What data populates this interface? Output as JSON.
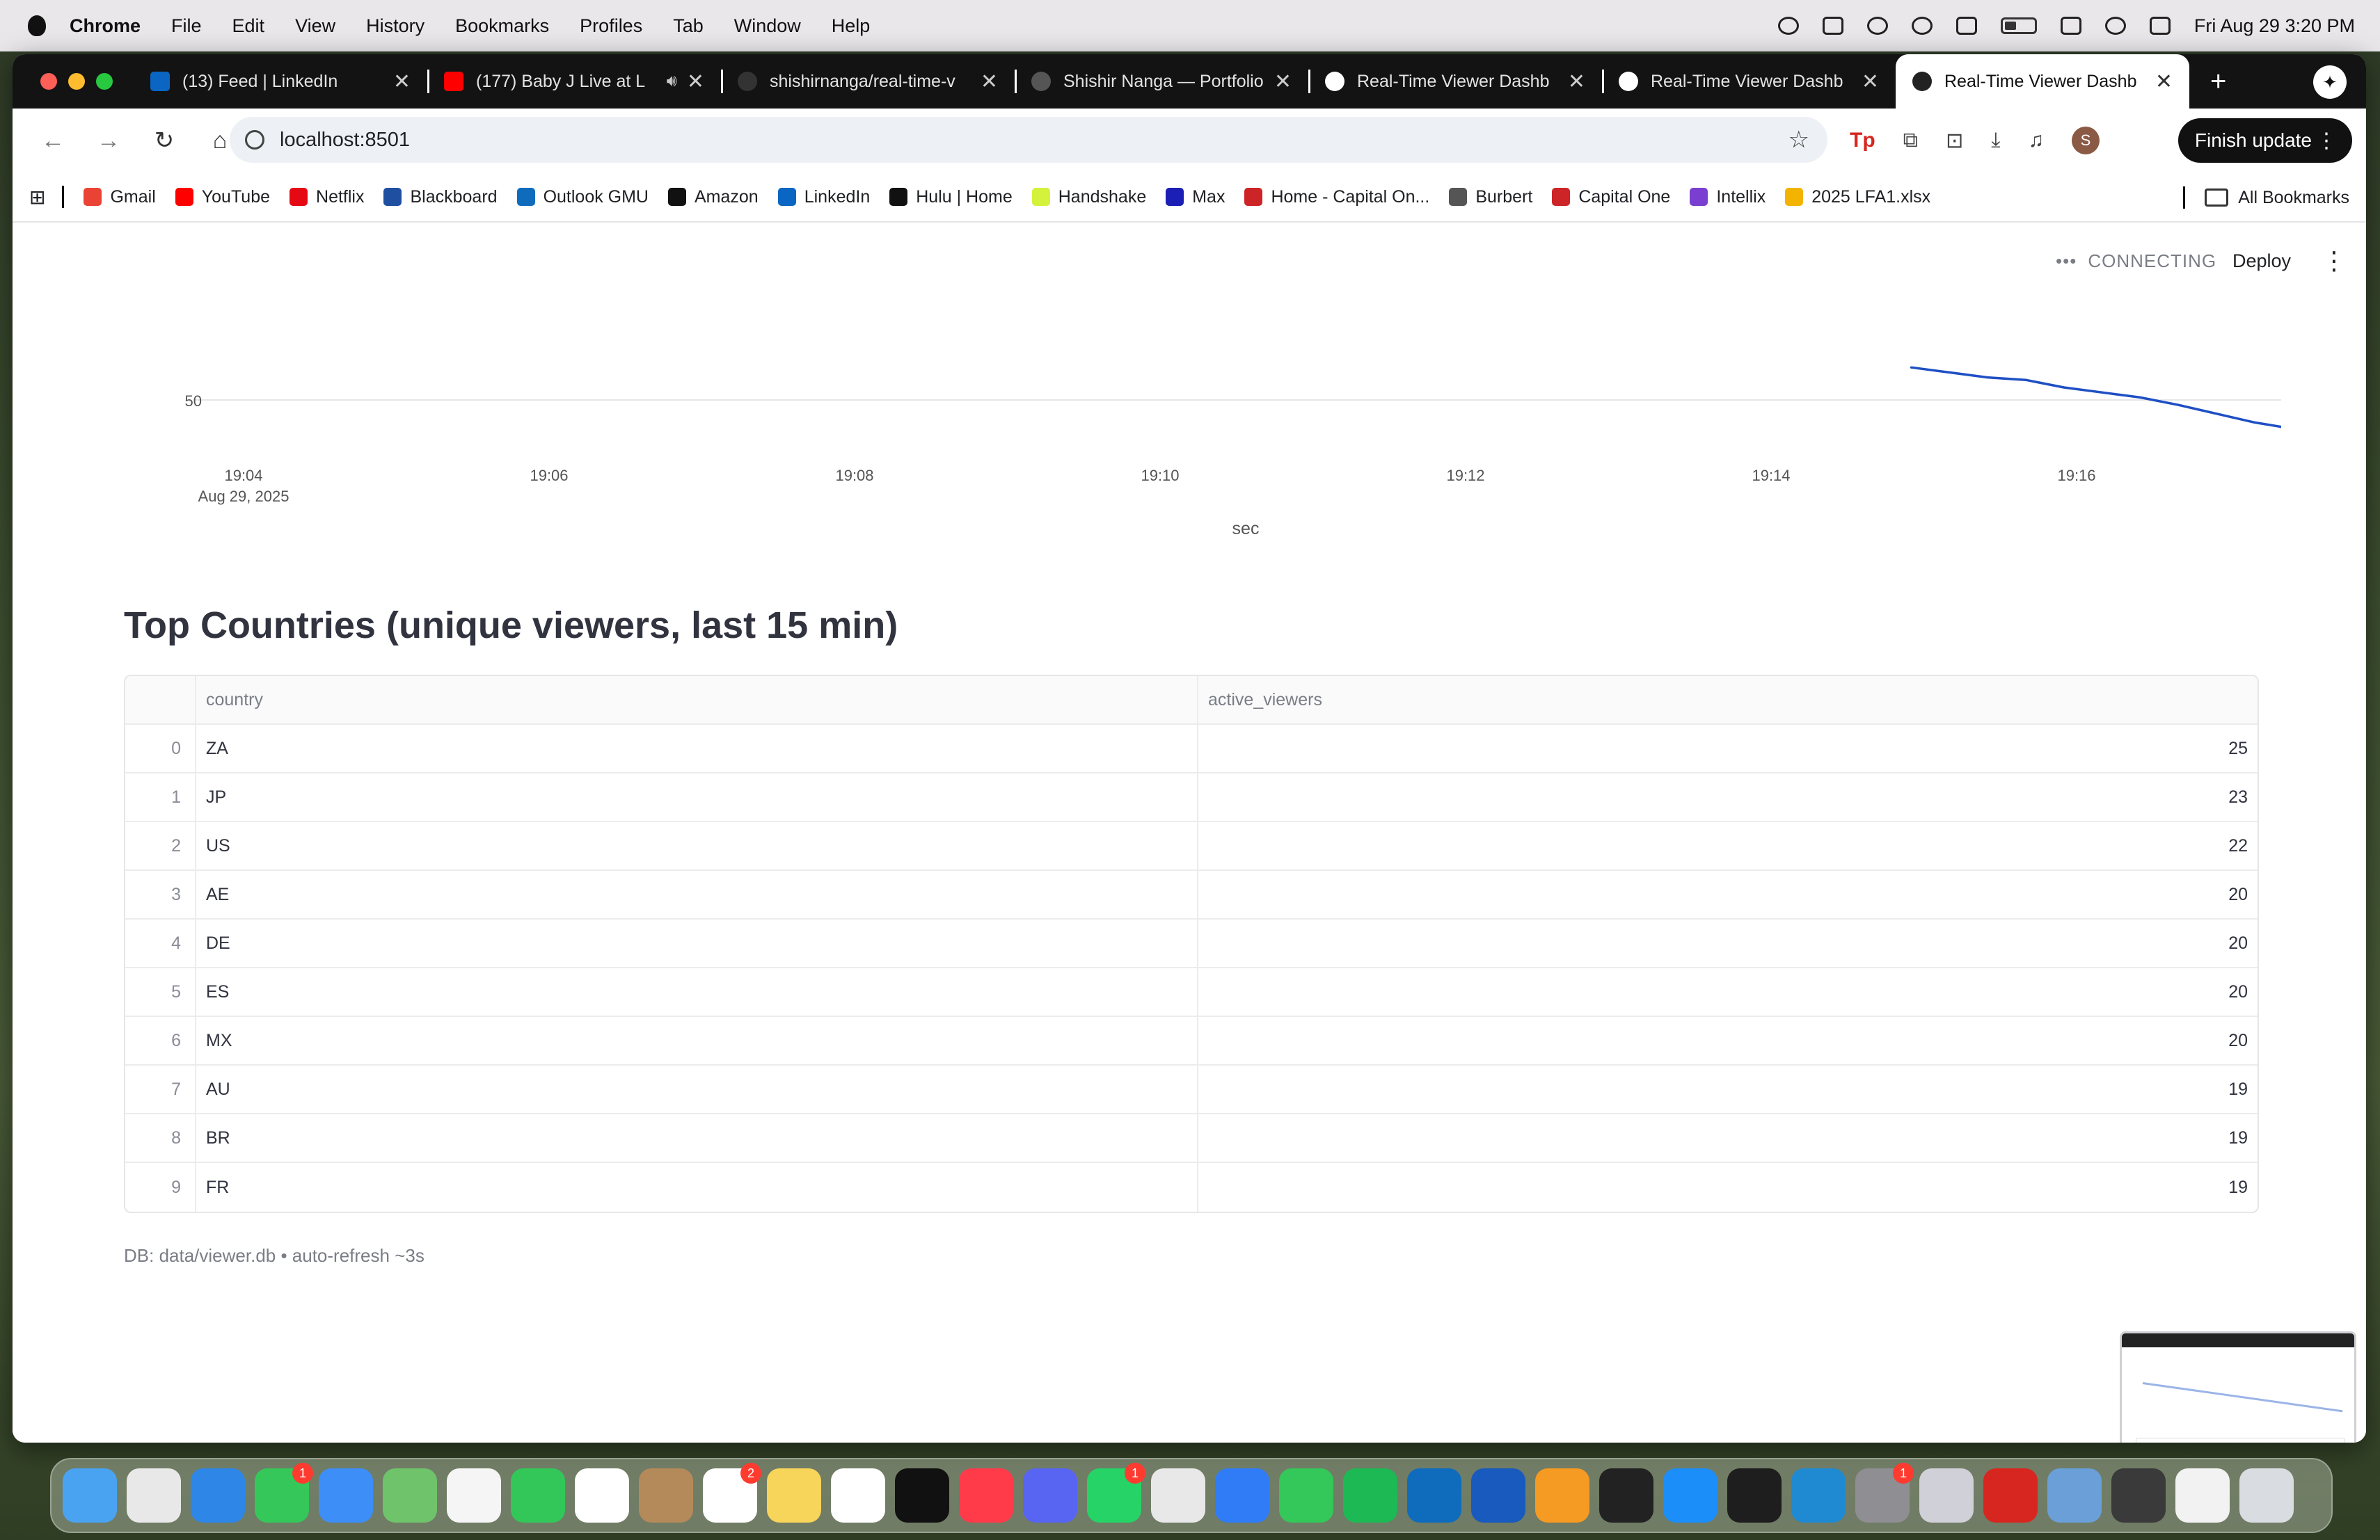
{
  "menubar": {
    "app": "Chrome",
    "items": [
      "File",
      "Edit",
      "View",
      "History",
      "Bookmarks",
      "Profiles",
      "Tab",
      "Window",
      "Help"
    ],
    "clock": "Fri Aug 29  3:20 PM"
  },
  "tabs": [
    {
      "title": "(13) Feed | LinkedIn",
      "color": "#0a66c2"
    },
    {
      "title": "(177) Baby J Live at L",
      "color": "#ff0000"
    },
    {
      "title": "shishirnanga/real-time-v",
      "color": "#333333"
    },
    {
      "title": "Shishir Nanga — Portfolio",
      "color": "#555555"
    },
    {
      "title": "Real-Time Viewer Dashb",
      "color": "#ffffff"
    },
    {
      "title": "Real-Time Viewer Dashb",
      "color": "#ffffff"
    },
    {
      "title": "Real-Time Viewer Dashb",
      "color": "#222222"
    }
  ],
  "address": {
    "url": "localhost:8501"
  },
  "finish_update": "Finish update",
  "avatar_letter": "S",
  "bookmarks": [
    {
      "label": "Gmail",
      "color": "#ea4335"
    },
    {
      "label": "YouTube",
      "color": "#ff0000"
    },
    {
      "label": "Netflix",
      "color": "#e50914"
    },
    {
      "label": "Blackboard",
      "color": "#1f4fa0"
    },
    {
      "label": "Outlook GMU",
      "color": "#0f6cbd"
    },
    {
      "label": "Amazon",
      "color": "#111111"
    },
    {
      "label": "LinkedIn",
      "color": "#0a66c2"
    },
    {
      "label": "Hulu | Home",
      "color": "#111111"
    },
    {
      "label": "Handshake",
      "color": "#d4f23b"
    },
    {
      "label": "Max",
      "color": "#1b1fb5"
    },
    {
      "label": "Home - Capital On...",
      "color": "#cc2427"
    },
    {
      "label": "Burbert",
      "color": "#555555"
    },
    {
      "label": "Capital One",
      "color": "#cc2427"
    },
    {
      "label": "Intellix",
      "color": "#7a3fd1"
    },
    {
      "label": "2025 LFA1.xlsx",
      "color": "#f2b400"
    }
  ],
  "all_bookmarks": "All Bookmarks",
  "app": {
    "status": "CONNECTING",
    "deploy": "Deploy",
    "section_title": "Top Countries (unique viewers, last 15 min)",
    "caption": "DB: data/viewer.db • auto-refresh ~3s"
  },
  "chart_data": {
    "type": "line",
    "xlabel": "sec",
    "ylabel": "",
    "y_tick": "50",
    "x_ticks": [
      "19:04",
      "19:06",
      "19:08",
      "19:10",
      "19:12",
      "19:14",
      "19:16"
    ],
    "x_sub": "Aug 29, 2025",
    "color": "#1f4fc4",
    "series": [
      {
        "x": [
          "19:14:55",
          "19:15:10",
          "19:15:25",
          "19:15:40",
          "19:15:55",
          "19:16:10",
          "19:16:25",
          "19:16:40",
          "19:16:55",
          "19:17:10",
          "19:17:25"
        ],
        "values": [
          52.6,
          52.2,
          51.8,
          51.6,
          51.0,
          50.6,
          50.2,
          49.6,
          48.9,
          48.2,
          47.7
        ]
      }
    ]
  },
  "table": {
    "columns": [
      "country",
      "active_viewers"
    ],
    "rows": [
      {
        "i": "0",
        "country": "ZA",
        "active_viewers": "25"
      },
      {
        "i": "1",
        "country": "JP",
        "active_viewers": "23"
      },
      {
        "i": "2",
        "country": "US",
        "active_viewers": "22"
      },
      {
        "i": "3",
        "country": "AE",
        "active_viewers": "20"
      },
      {
        "i": "4",
        "country": "DE",
        "active_viewers": "20"
      },
      {
        "i": "5",
        "country": "ES",
        "active_viewers": "20"
      },
      {
        "i": "6",
        "country": "MX",
        "active_viewers": "20"
      },
      {
        "i": "7",
        "country": "AU",
        "active_viewers": "19"
      },
      {
        "i": "8",
        "country": "BR",
        "active_viewers": "19"
      },
      {
        "i": "9",
        "country": "FR",
        "active_viewers": "19"
      }
    ]
  },
  "dock": [
    {
      "name": "finder-icon",
      "color": "#4aa3f0"
    },
    {
      "name": "launchpad-icon",
      "color": "#e8e8e8"
    },
    {
      "name": "safari-icon",
      "color": "#2e86e6"
    },
    {
      "name": "messages-icon",
      "color": "#35c759",
      "badge": "1"
    },
    {
      "name": "mail-icon",
      "color": "#3d8ef7"
    },
    {
      "name": "maps-icon",
      "color": "#6fc36a"
    },
    {
      "name": "photos-icon",
      "color": "#f5f5f5"
    },
    {
      "name": "facetime-icon",
      "color": "#33c759"
    },
    {
      "name": "calendar-icon",
      "color": "#ffffff"
    },
    {
      "name": "contacts-icon",
      "color": "#b48a5a"
    },
    {
      "name": "reminders-icon",
      "color": "#ffffff",
      "badge": "2"
    },
    {
      "name": "notes-icon",
      "color": "#f7d45a"
    },
    {
      "name": "freeform-icon",
      "color": "#ffffff"
    },
    {
      "name": "appletv-icon",
      "color": "#111111"
    },
    {
      "name": "news-icon",
      "color": "#ff3b4a"
    },
    {
      "name": "discord-icon",
      "color": "#5865f2"
    },
    {
      "name": "whatsapp-icon",
      "color": "#25d366",
      "badge": "1"
    },
    {
      "name": "chrome-icon",
      "color": "#e8e8e8"
    },
    {
      "name": "keynote-icon",
      "color": "#2f7cf6"
    },
    {
      "name": "numbers-icon",
      "color": "#34c759"
    },
    {
      "name": "spotify-icon",
      "color": "#1db954"
    },
    {
      "name": "outlook-icon",
      "color": "#0f6cbd"
    },
    {
      "name": "word-icon",
      "color": "#185abd"
    },
    {
      "name": "pages-icon",
      "color": "#f59a23"
    },
    {
      "name": "unity-icon",
      "color": "#222222"
    },
    {
      "name": "appstore-icon",
      "color": "#1c8ef9"
    },
    {
      "name": "terminal-icon",
      "color": "#1e1e1e"
    },
    {
      "name": "vscode-icon",
      "color": "#1f8ad2"
    },
    {
      "name": "settings-icon",
      "color": "#8e8e93",
      "badge": "1"
    },
    {
      "name": "iphone-mirroring-icon",
      "color": "#d0d0d8"
    },
    {
      "name": "acrobat-icon",
      "color": "#d7261f"
    },
    {
      "name": "preview-icon",
      "color": "#6a9fd8"
    },
    {
      "name": "garageband-icon",
      "color": "#3a3a3a"
    },
    {
      "name": "document-icon",
      "color": "#f2f2f2"
    },
    {
      "name": "trash-icon",
      "color": "#d9dde2"
    }
  ]
}
